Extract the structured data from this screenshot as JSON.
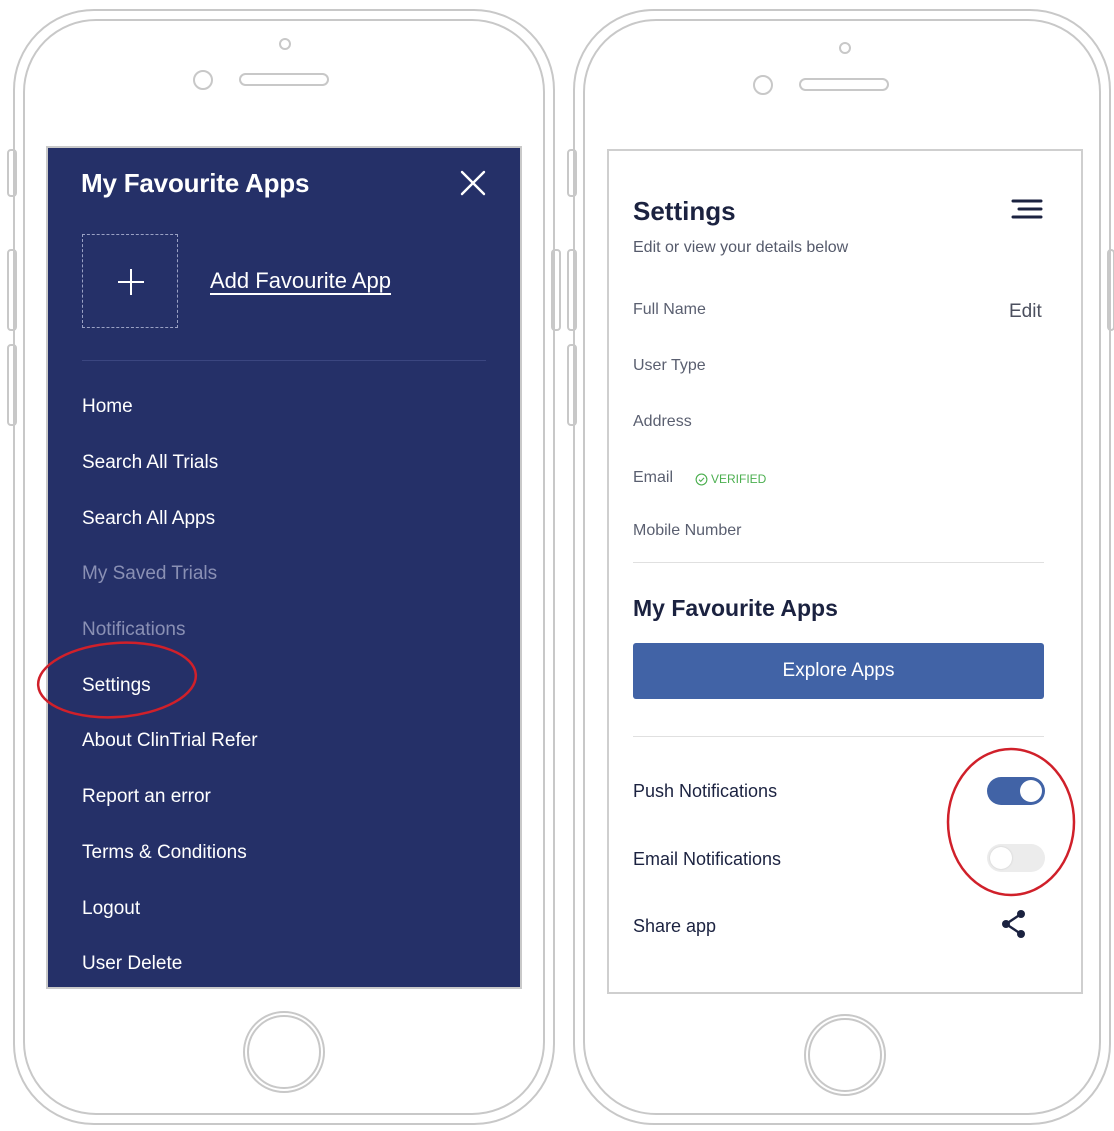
{
  "drawer": {
    "title": "My Favourite Apps",
    "add_label": "Add Favourite App",
    "items": [
      {
        "label": "Home",
        "state": "active"
      },
      {
        "label": "Search All Trials",
        "state": "active"
      },
      {
        "label": "Search All Apps",
        "state": "active"
      },
      {
        "label": "My Saved Trials",
        "state": "disabled"
      },
      {
        "label": "Notifications",
        "state": "disabled"
      },
      {
        "label": "Settings",
        "state": "highlighted"
      },
      {
        "label": "About ClinTrial Refer",
        "state": "active"
      },
      {
        "label": "Report an error",
        "state": "active"
      },
      {
        "label": "Terms & Conditions",
        "state": "active"
      },
      {
        "label": "Logout",
        "state": "active"
      },
      {
        "label": "User Delete",
        "state": "active"
      }
    ]
  },
  "settings": {
    "title": "Settings",
    "subtitle": "Edit or view your details below",
    "edit_label": "Edit",
    "fields": {
      "full_name": "Full Name",
      "user_type": "User Type",
      "address": "Address",
      "email": "Email",
      "email_status": "VERIFIED",
      "mobile": "Mobile Number"
    },
    "favourites_title": "My Favourite Apps",
    "explore_button": "Explore Apps",
    "push_notifications": {
      "label": "Push Notifications",
      "enabled": true
    },
    "email_notifications": {
      "label": "Email Notifications",
      "enabled": false
    },
    "share_label": "Share app"
  },
  "colors": {
    "drawer_bg": "#253068",
    "accent": "#4163a6",
    "verified": "#4caf50",
    "annotation": "#d0202a"
  }
}
